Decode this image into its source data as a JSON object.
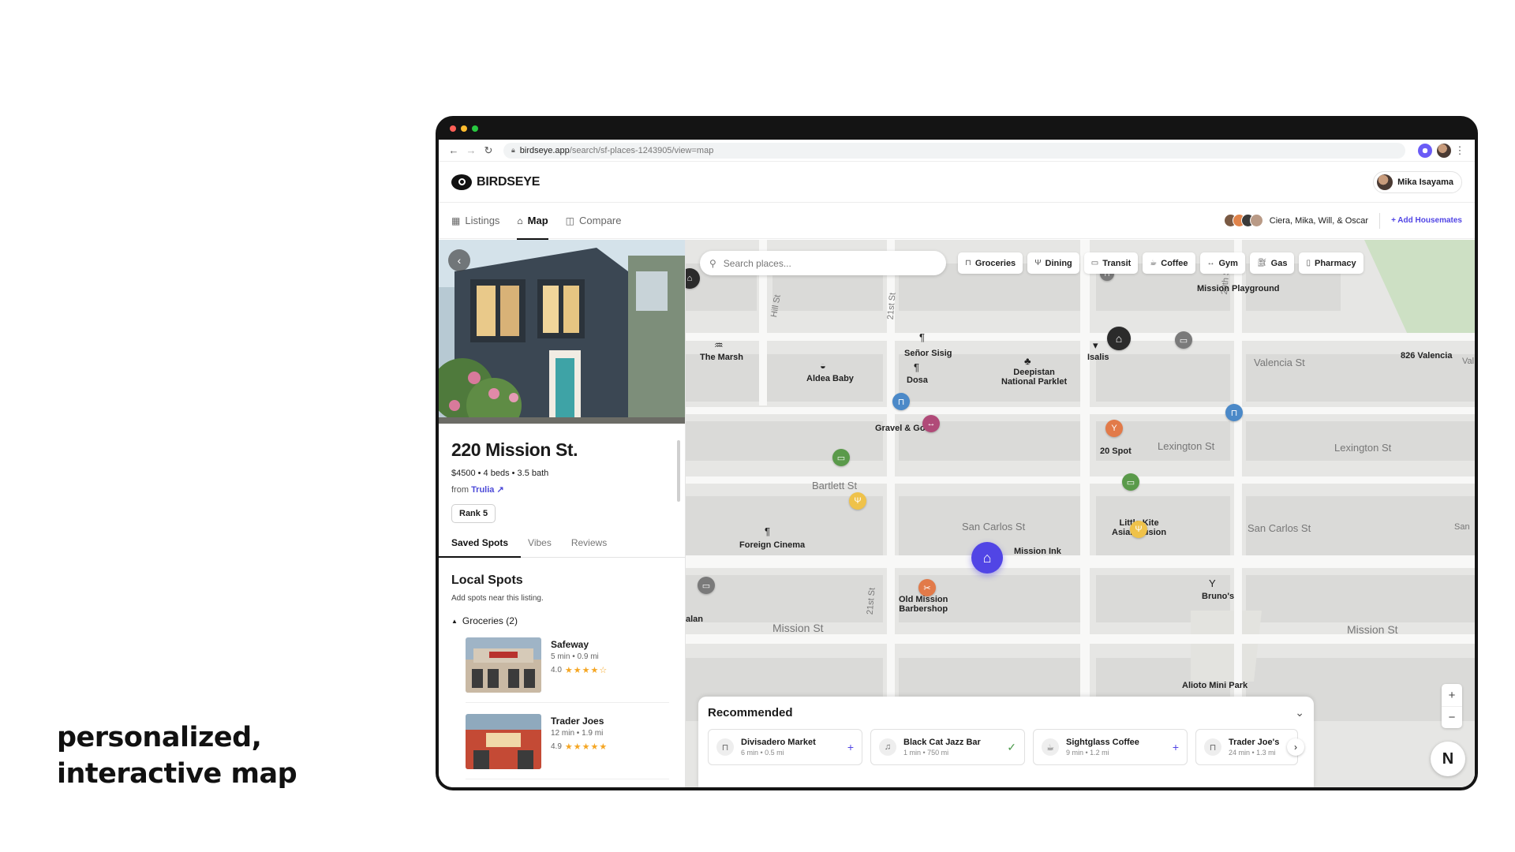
{
  "caption": {
    "line1": "personalized,",
    "line2": "interactive map"
  },
  "browser": {
    "url_host": "birdseye.app",
    "url_path": "/search/sf-places-1243905/view=map"
  },
  "app": {
    "brand": "BIRDSEYE",
    "user_name": "Mika Isayama",
    "tabs": [
      {
        "label": "Listings",
        "icon": "grid-icon"
      },
      {
        "label": "Map",
        "icon": "map-icon"
      },
      {
        "label": "Compare",
        "icon": "compare-icon"
      }
    ],
    "housemates": "Ciera, Mika, Will, & Oscar",
    "add_housemates": "+ Add Housemates"
  },
  "listing": {
    "address": "220 Mission St.",
    "meta": "$4500 • 4 beds • 3.5 bath",
    "from_label": "from",
    "source": "Trulia",
    "rank": "Rank 5",
    "subtabs": [
      "Saved Spots",
      "Vibes",
      "Reviews"
    ],
    "local_title": "Local Spots",
    "local_hint": "Add spots near this listing.",
    "group_label": "Groceries (2)",
    "spots": [
      {
        "name": "Safeway",
        "sub": "5 min • 0.9 mi",
        "rating": "4.0",
        "stars": "★★★★☆"
      },
      {
        "name": "Trader Joes",
        "sub": "12 min • 1.9 mi",
        "rating": "4.9",
        "stars": "★★★★★"
      }
    ]
  },
  "map": {
    "search_placeholder": "Search places...",
    "chips": [
      {
        "label": "Groceries",
        "icon": "basket-icon"
      },
      {
        "label": "Dining",
        "icon": "fork-icon"
      },
      {
        "label": "Transit",
        "icon": "bus-icon"
      },
      {
        "label": "Coffee",
        "icon": "cup-icon"
      },
      {
        "label": "Gym",
        "icon": "dumbbell-icon"
      },
      {
        "label": "Gas",
        "icon": "fuel-icon"
      },
      {
        "label": "Pharmacy",
        "icon": "pill-icon"
      }
    ],
    "streets": {
      "valencia": "Valencia St",
      "valencia2": "Val",
      "lexington1": "Lexington St",
      "lexington2": "Lexington St",
      "bartlett": "Bartlett St",
      "sancarlos1": "San Carlos St",
      "sancarlos2": "San Carlos St",
      "sancarlos3": "San",
      "mission1": "Mission St",
      "mission2": "Mission St",
      "hill": "Hill St",
      "st21a": "21st St",
      "st21b": "21st St",
      "st20": "20th St"
    },
    "places": {
      "marsh": "The Marsh",
      "senor": "Señor Sisig",
      "isalis": "Isalis",
      "valencia826": "826 Valencia",
      "playground": "Mission Playground",
      "aldea": "Aldea Baby",
      "dosa": "Dosa",
      "deepistan": "Deepistan\nNational Parklet",
      "gravel": "Gravel & Gol",
      "spot20": "20 Spot",
      "foreign": "Foreign Cinema",
      "missionink": "Mission Ink",
      "littlekite": "Little Kite\nAsian Fusion",
      "oldmission": "Old Mission\nBarbershop",
      "brunos": "Bruno's",
      "alamo": "alan",
      "minipark": "Alioto Mini Park"
    },
    "recommended_title": "Recommended",
    "recommended": [
      {
        "name": "Divisadero Market",
        "sub": "6 min • 0.5 mi",
        "action": "+"
      },
      {
        "name": "Black Cat Jazz Bar",
        "sub": "1 min • 750 mi",
        "action": "✓"
      },
      {
        "name": "Sightglass Coffee",
        "sub": "9 min • 1.2 mi",
        "action": "+"
      },
      {
        "name": "Trader Joe's",
        "sub": "24 min • 1.3 mi",
        "action": ""
      }
    ],
    "compass": "N"
  }
}
